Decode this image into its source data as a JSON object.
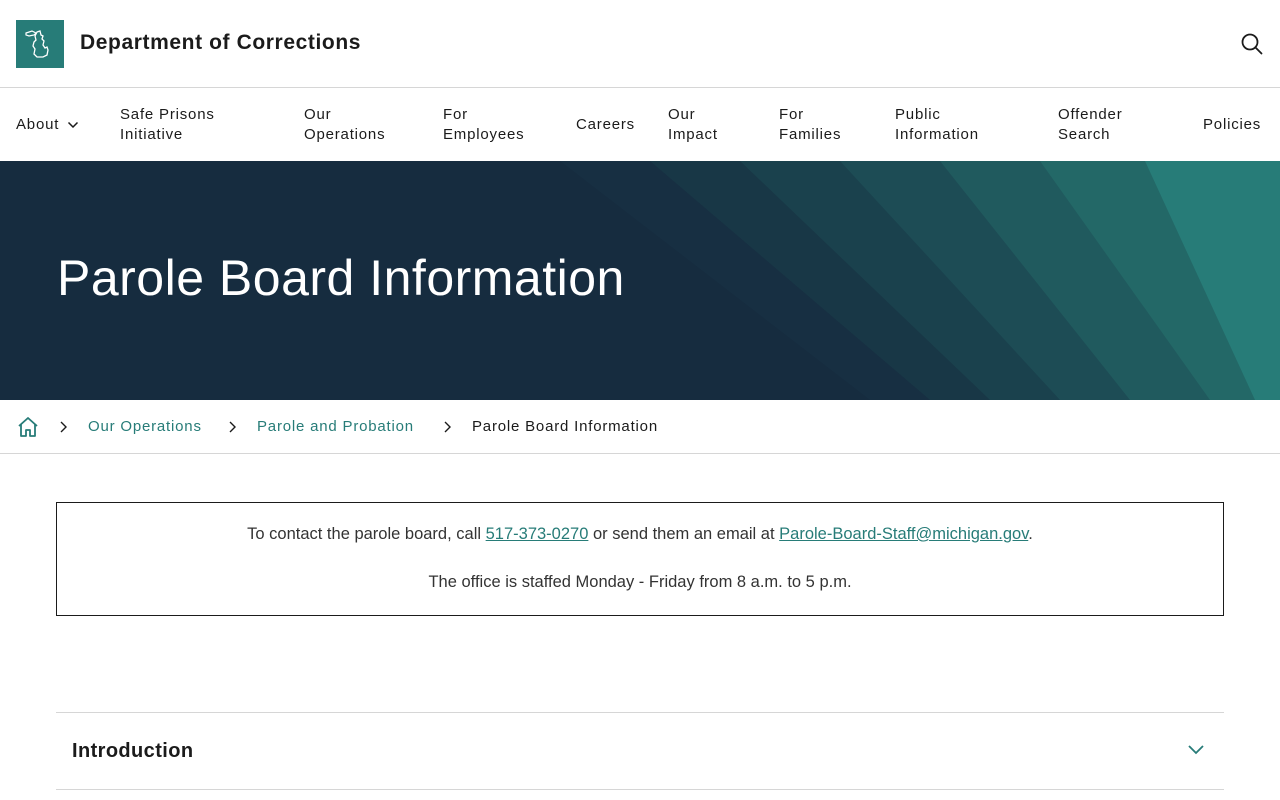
{
  "header": {
    "site_title": "Department of Corrections",
    "logo_icon": "michigan-state-icon",
    "search_icon": "search-icon"
  },
  "nav": {
    "items": [
      {
        "line1": "About",
        "line2": "",
        "has_dropdown": true
      },
      {
        "line1": "Safe Prisons",
        "line2": "Initiative"
      },
      {
        "line1": "Our",
        "line2": "Operations"
      },
      {
        "line1": "For",
        "line2": "Employees"
      },
      {
        "line1": "Careers",
        "line2": ""
      },
      {
        "line1": "Our",
        "line2": "Impact"
      },
      {
        "line1": "For",
        "line2": "Families"
      },
      {
        "line1": "Public",
        "line2": "Information"
      },
      {
        "line1": "Offender",
        "line2": "Search"
      },
      {
        "line1": "Policies",
        "line2": ""
      }
    ]
  },
  "hero": {
    "title": "Parole Board Information"
  },
  "breadcrumb": {
    "home_icon": "home-icon",
    "links": [
      "Our Operations",
      "Parole and Probation"
    ],
    "current": "Parole Board Information"
  },
  "contact": {
    "line1_prefix": "To contact the parole board, call ",
    "phone": "517-373-0270",
    "line1_middle": " or send them an email at ",
    "email": "Parole-Board-Staff@michigan.gov",
    "line1_suffix": ".",
    "line2": "The office is staffed Monday - Friday from 8 a.m. to 5 p.m."
  },
  "accordion": {
    "title": "Introduction"
  },
  "colors": {
    "accent": "#277c78",
    "hero_dark": "#162c3f",
    "text": "#1b1b1b"
  }
}
